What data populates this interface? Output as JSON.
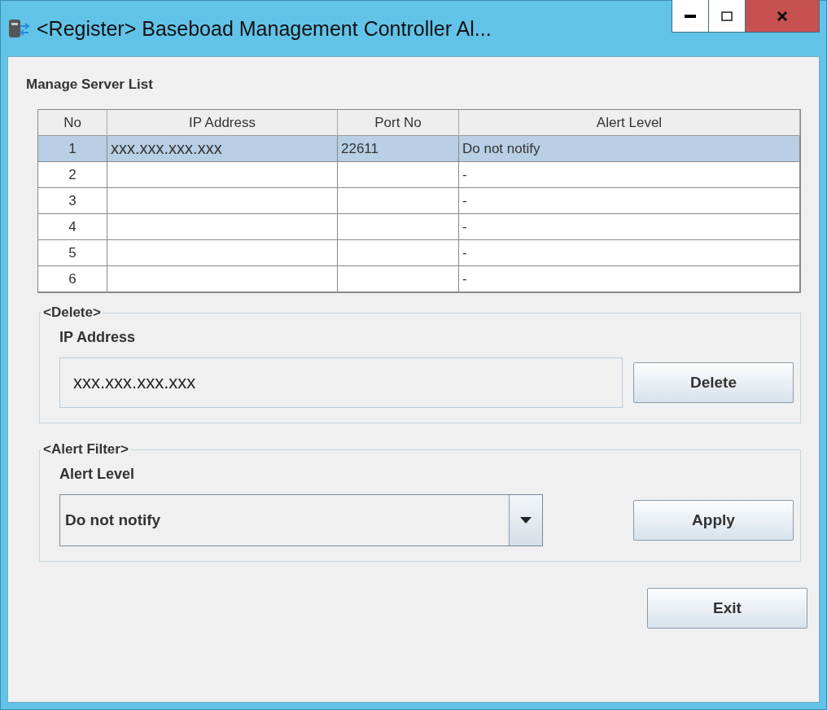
{
  "window": {
    "title": "<Register> Baseboad Management Controller Al..."
  },
  "section_title": "Manage Server List",
  "table": {
    "columns": [
      "No",
      "IP Address",
      "Port No",
      "Alert Level"
    ],
    "rows": [
      {
        "cells": [
          "1",
          "xxx.xxx.xxx.xxx",
          "22611",
          "Do not notify"
        ],
        "selected": true
      },
      {
        "cells": [
          "2",
          "",
          "",
          "-"
        ],
        "selected": false
      },
      {
        "cells": [
          "3",
          "",
          "",
          "-"
        ],
        "selected": false
      },
      {
        "cells": [
          "4",
          "",
          "",
          "-"
        ],
        "selected": false
      },
      {
        "cells": [
          "5",
          "",
          "",
          "-"
        ],
        "selected": false
      },
      {
        "cells": [
          "6",
          "",
          "",
          "-"
        ],
        "selected": false
      }
    ]
  },
  "delete_group": {
    "title": "<Delete>",
    "label": "IP Address",
    "value": "xxx.xxx.xxx.xxx",
    "button": "Delete"
  },
  "filter_group": {
    "title": "<Alert Filter>",
    "label": "Alert Level",
    "value": "Do not notify",
    "button": "Apply"
  },
  "exit_button": "Exit"
}
